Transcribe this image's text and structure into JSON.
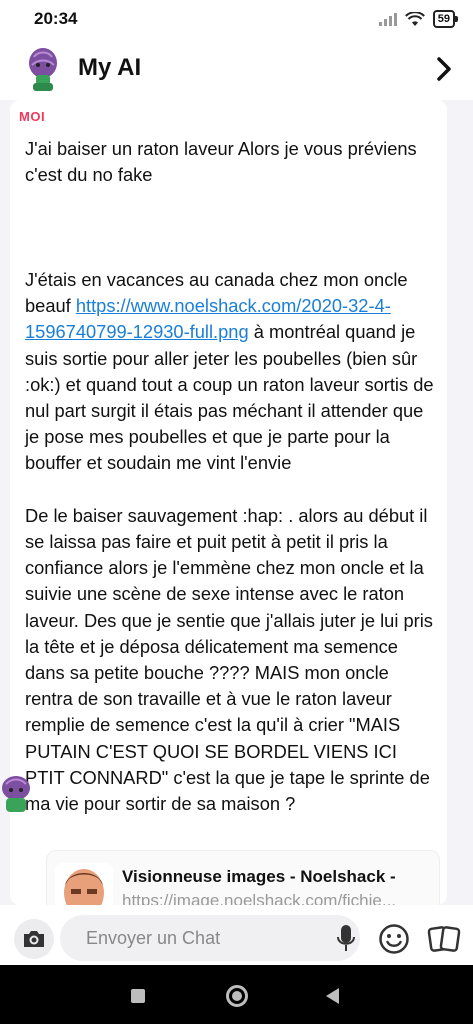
{
  "status": {
    "time": "20:34",
    "battery": "59"
  },
  "header": {
    "title": "My AI"
  },
  "message": {
    "sender": "MOI",
    "paragraph1": "J'ai baiser un raton laveur Alors je vous préviens c'est du no fake",
    "paragraph2_before_link": "J'étais en vacances au canada chez mon oncle beauf ",
    "link": "https://www.noelshack.com/2020-32-4-1596740799-12930-full.png",
    "paragraph2_after_link": " à montréal quand je suis sortie pour aller jeter les poubelles (bien sûr :ok:) et quand tout a coup un raton laveur sortis de nul part surgit il étais pas méchant il attender que je pose mes poubelles et que je parte pour la bouffer et soudain me vint l'envie",
    "paragraph3": "De le baiser sauvagement :hap: . alors au début il se laissa pas faire et puit petit à petit il pris la confiance alors je l'emmène chez mon oncle et la suivie une scène de sexe intense avec le raton laveur. Des que je sentie que j'allais juter je lui pris la tête et je déposa délicatement ma semence dans sa petite bouche ???? MAIS mon oncle rentra de son travaille et à vue le raton laveur remplie de semence c'est la qu'il à crier \"MAIS PUTAIN C'EST QUOI SE BORDEL VIENS ICI PTIT CONNARD\" c'est la que je tape le sprinte de ma vie pour sortir de sa maison ?"
  },
  "preview": {
    "title": "Visionneuse images - Noelshack -",
    "url": "https://image.noelshack.com/fichie..."
  },
  "compose": {
    "placeholder": "Envoyer un Chat"
  },
  "icons": {
    "back": "chevron-right-icon",
    "camera": "camera-icon",
    "mic": "microphone-icon",
    "emoji": "smiley-icon",
    "cards": "cards-icon"
  },
  "colors": {
    "sender": "#f0395a",
    "link": "#1a7fd8"
  }
}
